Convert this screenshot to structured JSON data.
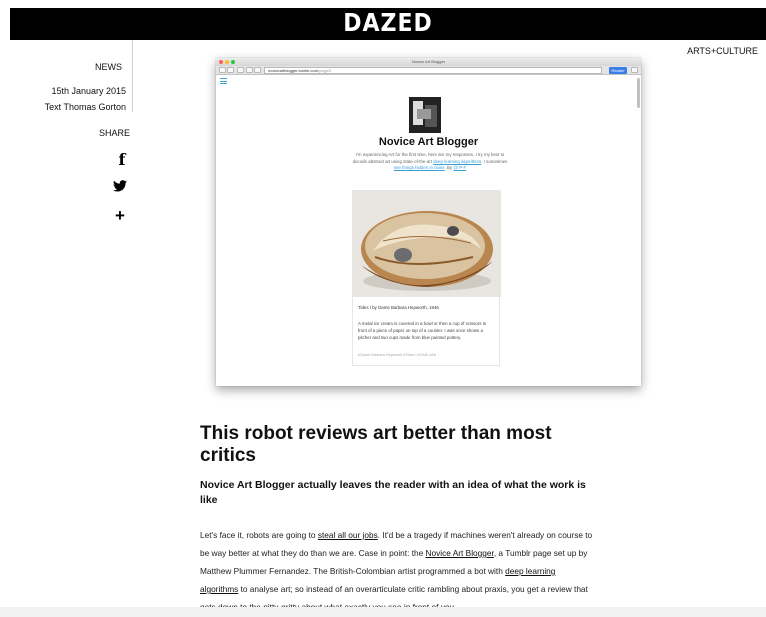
{
  "header": {
    "logo": "DAZED"
  },
  "meta": {
    "category": "ARTS+CULTURE",
    "section": "NEWS",
    "date": "15th January 2015",
    "author": "Text Thomas Gorton"
  },
  "share": {
    "label": "SHARE",
    "facebook_glyph": "f",
    "twitter_glyph": "🐦",
    "more_glyph": "+",
    "icons": [
      "facebook-icon",
      "twitter-icon",
      "plus-icon"
    ]
  },
  "screenshot": {
    "window_title": "Novice Art Blogger",
    "url": "noviceartblogger.tumblr.com",
    "url_suffix": "/page/3",
    "reader_label": "Reader",
    "blog_title": "Novice Art Blogger",
    "desc_part1": "I'm experiencing Art for the first time, here are my responses. I try my best to decode abstract art using state-of-the-art ",
    "desc_link1": "deep learning algorithms",
    "desc_part2": ", I sometimes ",
    "desc_link2": "see things hidden in noise",
    "desc_part3": ". By ",
    "desc_link3": "@ P-F",
    "caption": "Tides I by Dame Barbara Hepworth, 1946",
    "card_text": "A metal ice cream is covered in a bowl or then a cup of scissors in front of a piece of paper on top of a counter. I was once shown a pitcher and two cups made from blue painted pottery.",
    "tags": "#Dame Barbara Hepworth   #Tides I   #1946   #Art"
  },
  "article": {
    "headline": "This robot reviews art better than most critics",
    "subhead": "Novice Art Blogger actually leaves the reader with an idea of what the work is like",
    "p1": "Let's face it, robots are going to ",
    "l1": "steal all our jobs",
    "p2": ". It'd be a tragedy if machines weren't already on course to be way better at what they do than we are. Case in point: the ",
    "l2": "Novice Art Blogger",
    "p3": ", a Tumblr page set up by Matthew Plummer Fernandez. The British-Colombian artist programmed a bot with ",
    "l3": "deep learning algorithms",
    "p4": " to analyse art; so instead of an overarticulate critic rambling about praxis, you get a review that gets down to the nitty-gritty about what exactly you see in front of you."
  },
  "colors": {
    "brand_bar": "#000000",
    "link_blue": "#3aa0d8",
    "reader_blue": "#3a7ee8"
  }
}
